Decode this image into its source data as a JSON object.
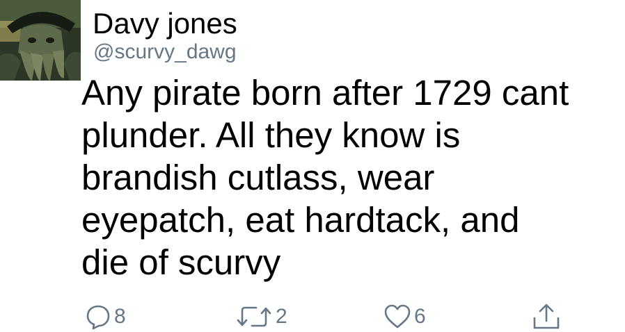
{
  "tweet": {
    "display_name": "Davy jones",
    "handle": "@scurvy_dawg",
    "text": "Any pirate born after 1729 cant\nplunder. All they know is\nbrandish cutlass, wear\neyepatch, eat hardtack, and\ndie of scurvy"
  },
  "actions": {
    "reply_count": "8",
    "retweet_count": "2",
    "like_count": "6"
  },
  "colors": {
    "text": "#000000",
    "secondary": "#657786",
    "background": "#ffffff"
  },
  "icons": {
    "reply": "speech-bubble-icon",
    "retweet": "retweet-arrows-icon",
    "like": "heart-icon",
    "share": "share-upload-icon"
  }
}
